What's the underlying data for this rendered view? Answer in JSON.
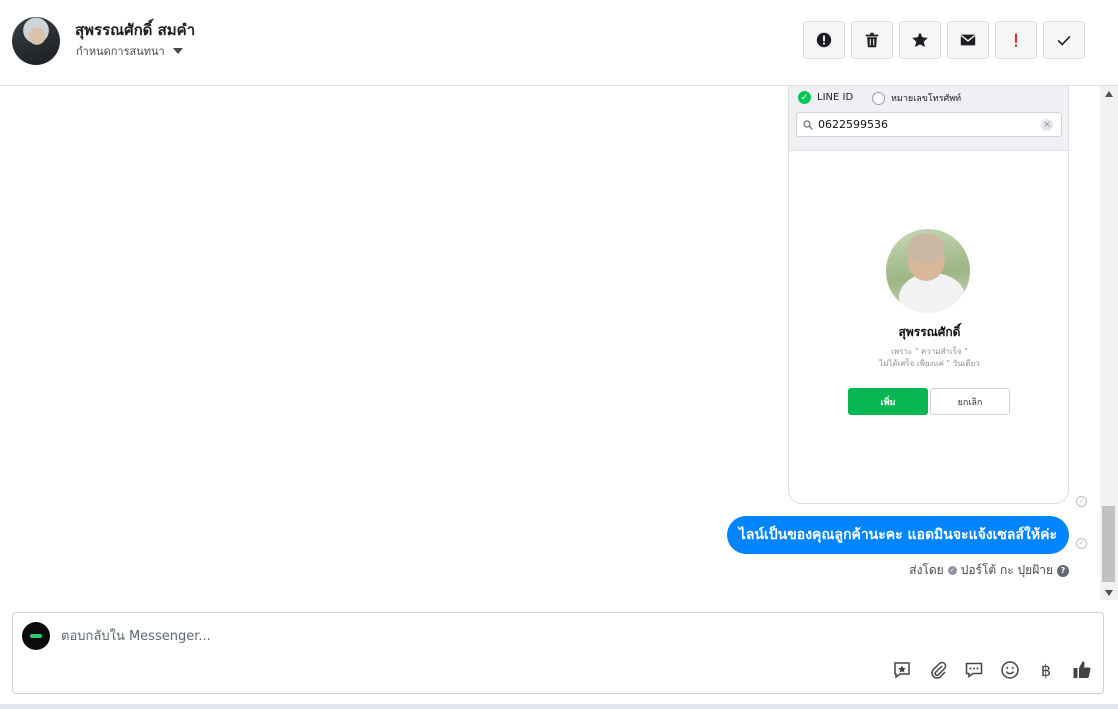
{
  "header": {
    "contact_name": "สุพรรณศักดิ์ สมคำ",
    "assign_label": "กำหนดการสนทนา",
    "tools": [
      {
        "icon": "alert-circle-icon"
      },
      {
        "icon": "trash-icon"
      },
      {
        "icon": "star-icon"
      },
      {
        "icon": "envelope-icon"
      },
      {
        "icon": "exclamation-icon",
        "color": "#e02e2e"
      },
      {
        "icon": "checkmark-icon"
      }
    ]
  },
  "shared_image": {
    "option_line_id": "LINE ID",
    "option_phone": "หมายเลขโทรศัพท์",
    "search_value": "0622599536",
    "profile_name": "สุพรรณศักดิ์",
    "status_line1": "เพราะ \" ความสำเร็จ \"",
    "status_line2": "ไม่ได้เสร็จ เพียงแค่ \" วันเดียว",
    "add_button": "เพิ่ม",
    "cancel_button": "ยกเลิก"
  },
  "message": {
    "text": "ไลน์เป็นของคุณลูกค้านะคะ แอดมินจะแจ้งเซลส์ให้ค่ะ",
    "sent_by_label": "ส่งโดย",
    "sender": "ปอร์โต้ กะ ปุยฝ้าย",
    "bubble_color": "#0084ff"
  },
  "composer": {
    "placeholder": "ตอบกลับใน Messenger...",
    "tools": [
      "saved-reply-icon",
      "attachment-icon",
      "chat-bubble-icon",
      "emoji-icon",
      "baht-icon",
      "thumbs-up-icon"
    ],
    "baht_symbol": "฿"
  },
  "colors": {
    "line_green": "#06c755",
    "messenger_blue": "#0084ff"
  }
}
